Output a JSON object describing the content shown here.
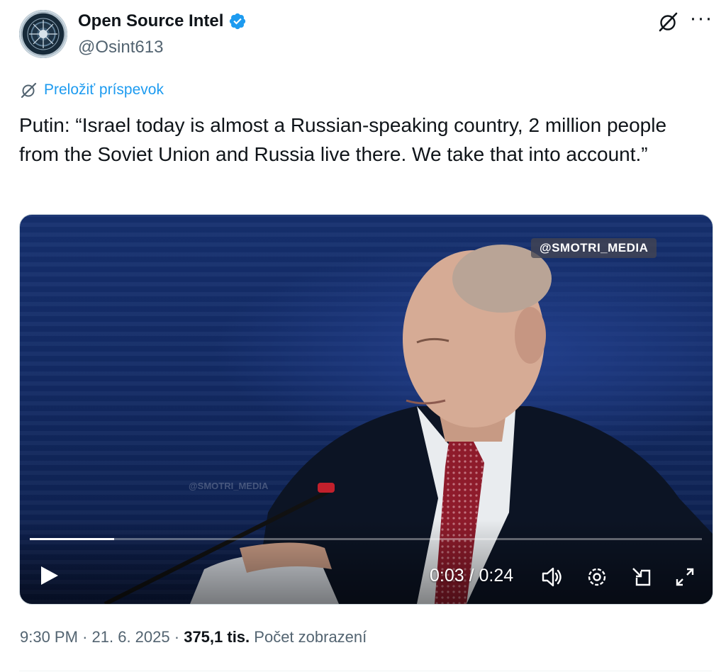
{
  "author": {
    "name": "Open Source Intel",
    "handle": "@Osint613",
    "avatar_icon": "osint-emblem-avatar",
    "verified_icon": "verified-badge-icon",
    "verified_color": "#1d9bf0"
  },
  "header_actions": {
    "grok_icon": "grok-icon",
    "more_icon": "more-horizontal-icon",
    "more_glyph": "···"
  },
  "translate": {
    "icon": "grok-translate-icon",
    "label": "Preložiť príspevok"
  },
  "tweet": {
    "text": "Putin: “Israel today is almost a Russian-speaking country, 2 million people from the Soviet Union and Russia live there. We take that into account.”"
  },
  "video": {
    "watermark": "@SMOTRI_MEDIA",
    "watermark_faint": "@SMOTRI_MEDIA",
    "current_time": "0:03",
    "duration": "0:24",
    "time_display": "0:03 / 0:24",
    "progress_fraction": 0.125,
    "controls": {
      "play_icon": "play-icon",
      "volume_icon": "volume-icon",
      "settings_icon": "settings-gear-icon",
      "dock_icon": "picture-in-picture-icon",
      "fullscreen_icon": "fullscreen-icon"
    }
  },
  "meta": {
    "time": "9:30 PM",
    "separator": "·",
    "date": "21. 6. 2025",
    "views_count": "375,1 tis.",
    "views_label": "Počet zobrazení"
  },
  "colors": {
    "accent": "#1d9bf0",
    "text_primary": "#0f1419",
    "text_secondary": "#536471"
  }
}
